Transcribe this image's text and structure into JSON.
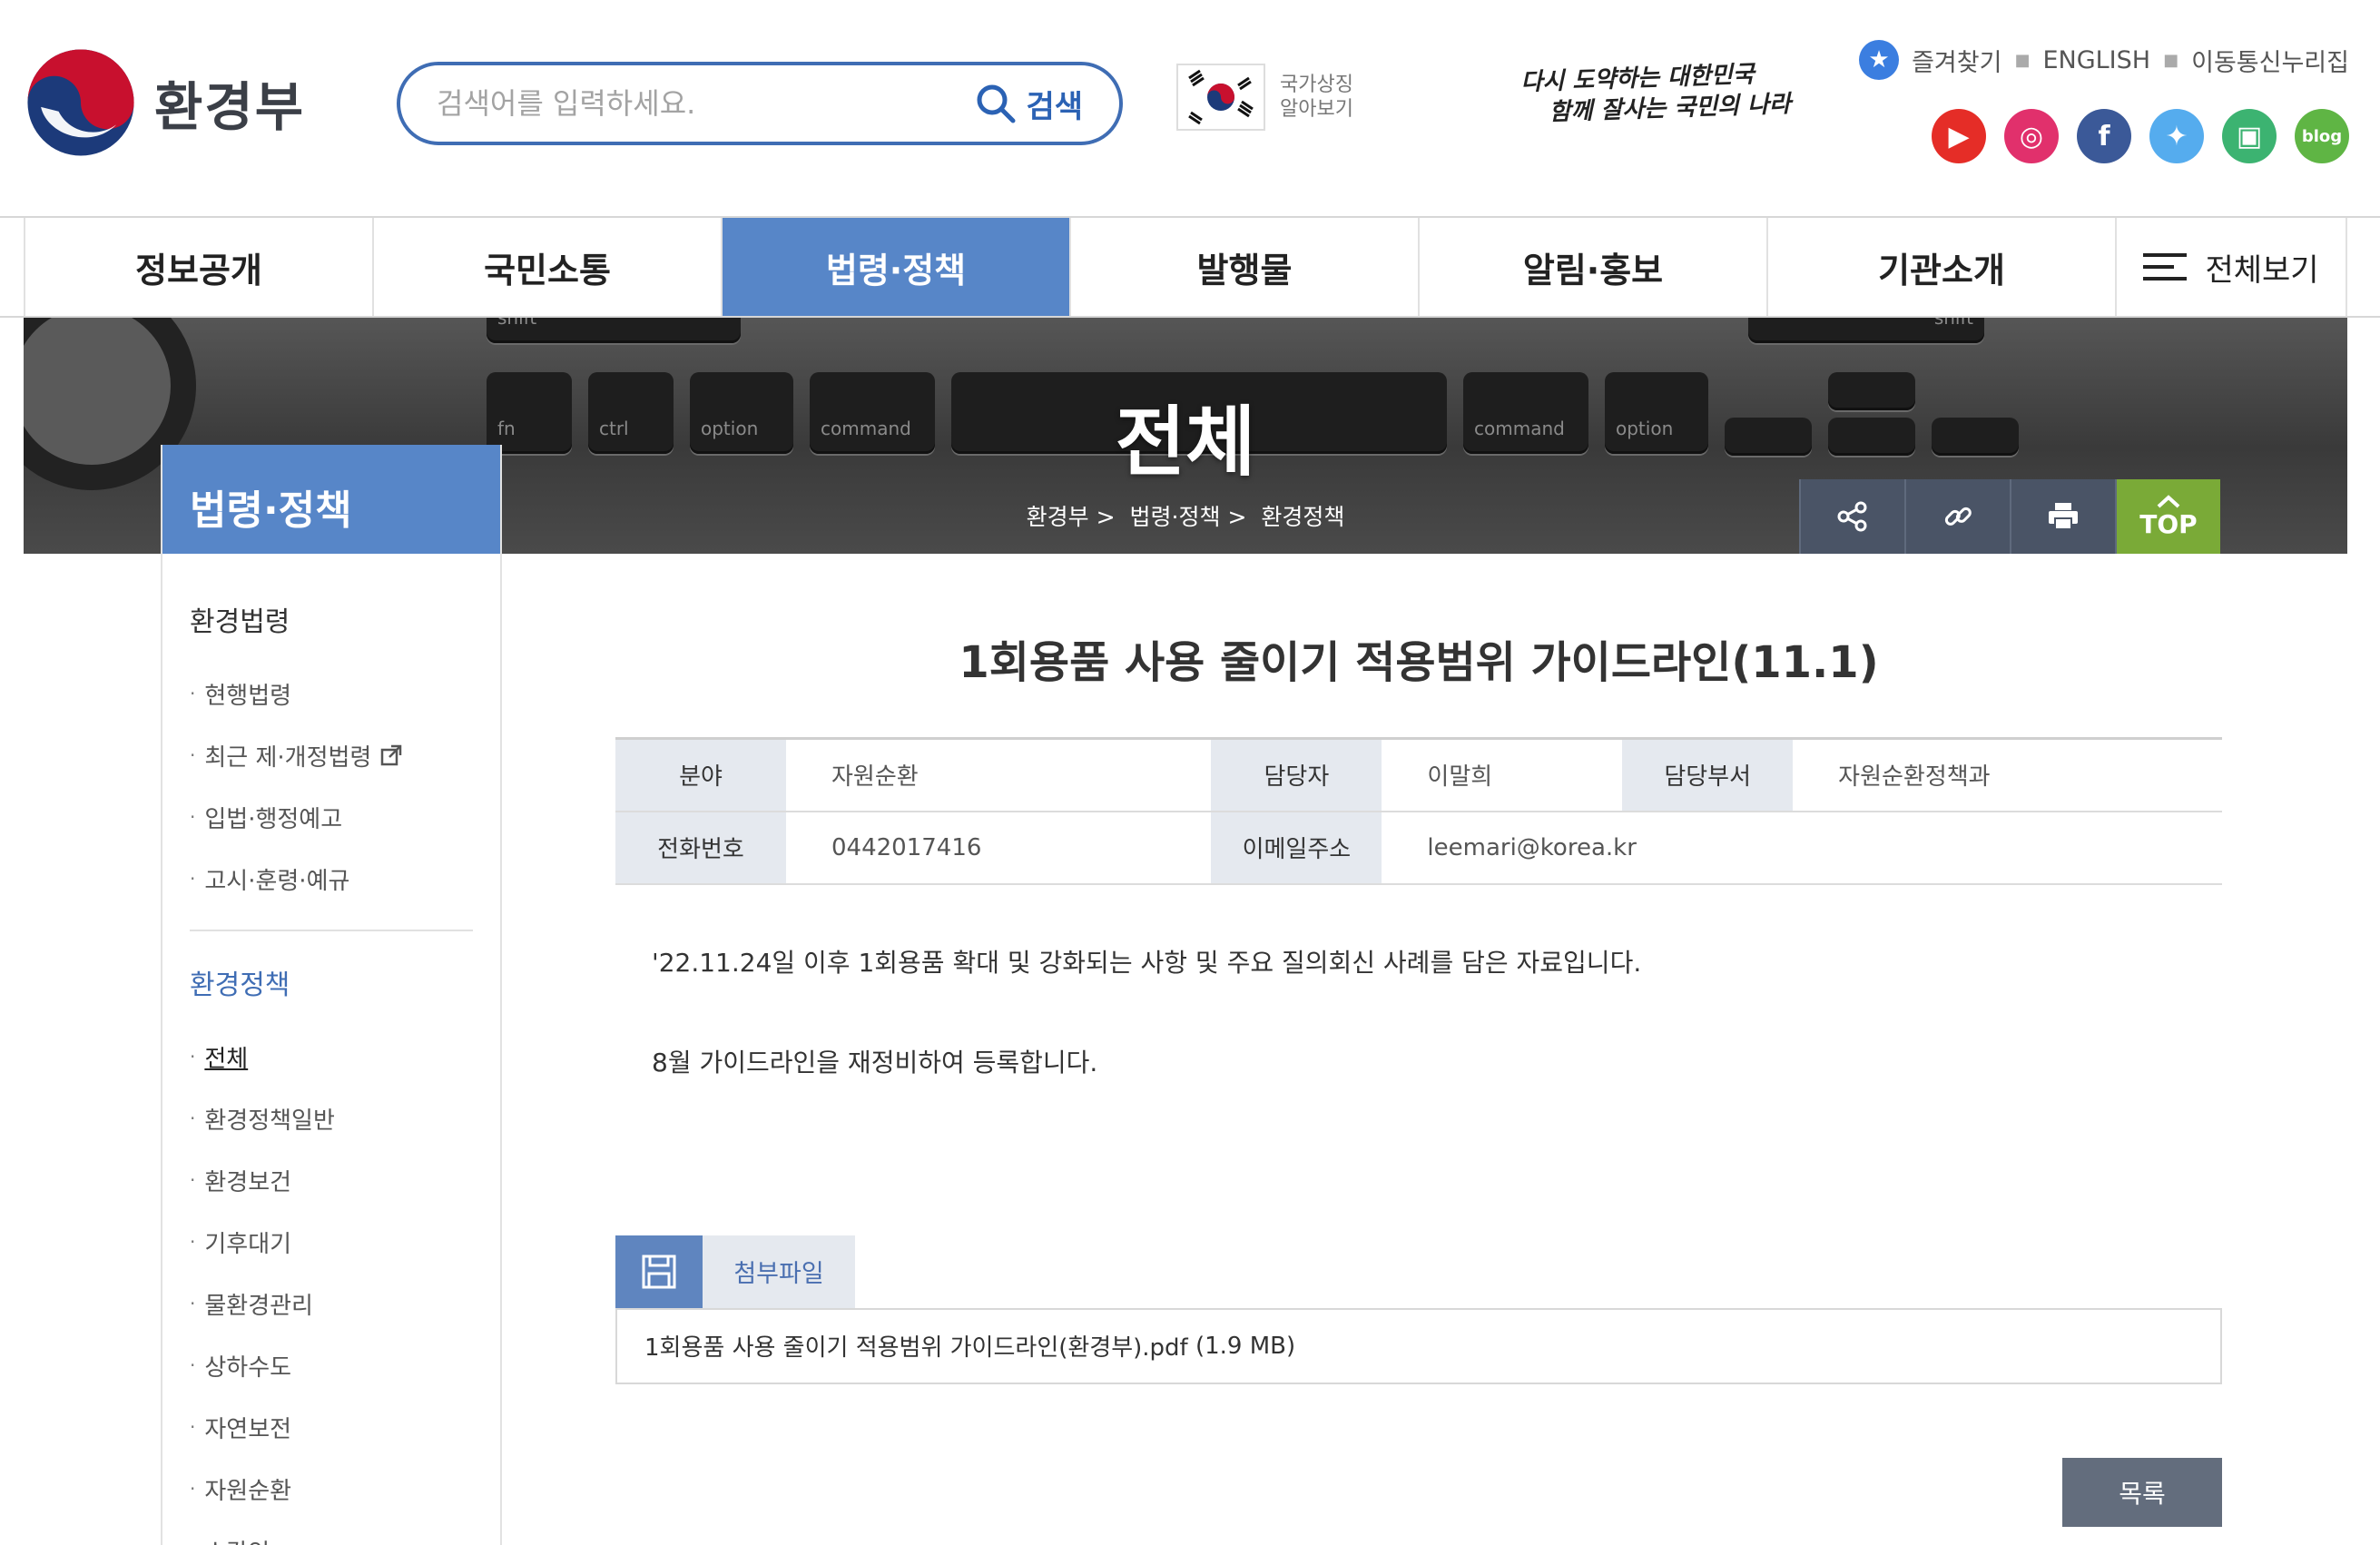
{
  "header": {
    "logo_text": "환경부",
    "search_placeholder": "검색어를 입력하세요.",
    "search_label": "검색",
    "symbol_line1": "국가상징",
    "symbol_line2": "알아보기",
    "slogan_line1": "다시 도약하는 대한민국",
    "slogan_line2": "함께 잘사는 국민의 나라",
    "util": [
      "즐겨찾기",
      "ENGLISH",
      "이동통신누리집"
    ],
    "sns": [
      {
        "name": "youtube",
        "color": "#e52d27",
        "glyph": "▶"
      },
      {
        "name": "instagram",
        "color": "#e1306c",
        "glyph": "◎"
      },
      {
        "name": "facebook",
        "color": "#3b5998",
        "glyph": "f"
      },
      {
        "name": "twitter",
        "color": "#55acee",
        "glyph": "✦"
      },
      {
        "name": "podcast",
        "color": "#3cb371",
        "glyph": "▣"
      },
      {
        "name": "blog",
        "color": "#5fb544",
        "glyph": "blog"
      }
    ]
  },
  "gnb": {
    "items": [
      "정보공개",
      "국민소통",
      "법령·정책",
      "발행물",
      "알림·홍보",
      "기관소개"
    ],
    "active_index": 2,
    "all_label": "전체보기"
  },
  "visual": {
    "title": "전체",
    "breadcrumb": [
      "환경부",
      "법령·정책",
      "환경정책"
    ],
    "top_label": "TOP",
    "keys": [
      "shift",
      "fn",
      "ctrl",
      "option",
      "command",
      "command",
      "option",
      "shift"
    ]
  },
  "lnb": {
    "head": "법령·정책",
    "sections": [
      {
        "title": "환경법령",
        "highlight": false,
        "items": [
          "현행법령",
          "최근 제·개정법령",
          "입법·행정예고",
          "고시·훈령·예규"
        ]
      },
      {
        "title": "환경정책",
        "highlight": true,
        "items": [
          "전체",
          "환경정책일반",
          "환경보건",
          "기후대기",
          "물환경관리",
          "상하수도",
          "자연보전",
          "자원순환",
          "소각인"
        ]
      }
    ],
    "current": "전체"
  },
  "post": {
    "title": "1회용품 사용 줄이기 적용범위 가이드라인(11.1)",
    "info": {
      "field_label": "분야",
      "field_value": "자원순환",
      "manager_label": "담당자",
      "manager_value": "이말희",
      "dept_label": "담당부서",
      "dept_value": "자원순환정책과",
      "phone_label": "전화번호",
      "phone_value": "0442017416",
      "email_label": "이메일주소",
      "email_value": "leemari@korea.kr"
    },
    "body": [
      "'22.11.24일 이후 1회용품 확대 및 강화되는 사항 및 주요 질의회신 사례를 담은 자료입니다.",
      "8월 가이드라인을 재정비하여 등록합니다."
    ],
    "attach_label": "첨부파일",
    "attach_file": "1회용품 사용 줄이기 적용범위 가이드라인(환경부).pdf",
    "attach_size": "(1.9 MB)",
    "list_button": "목록"
  }
}
